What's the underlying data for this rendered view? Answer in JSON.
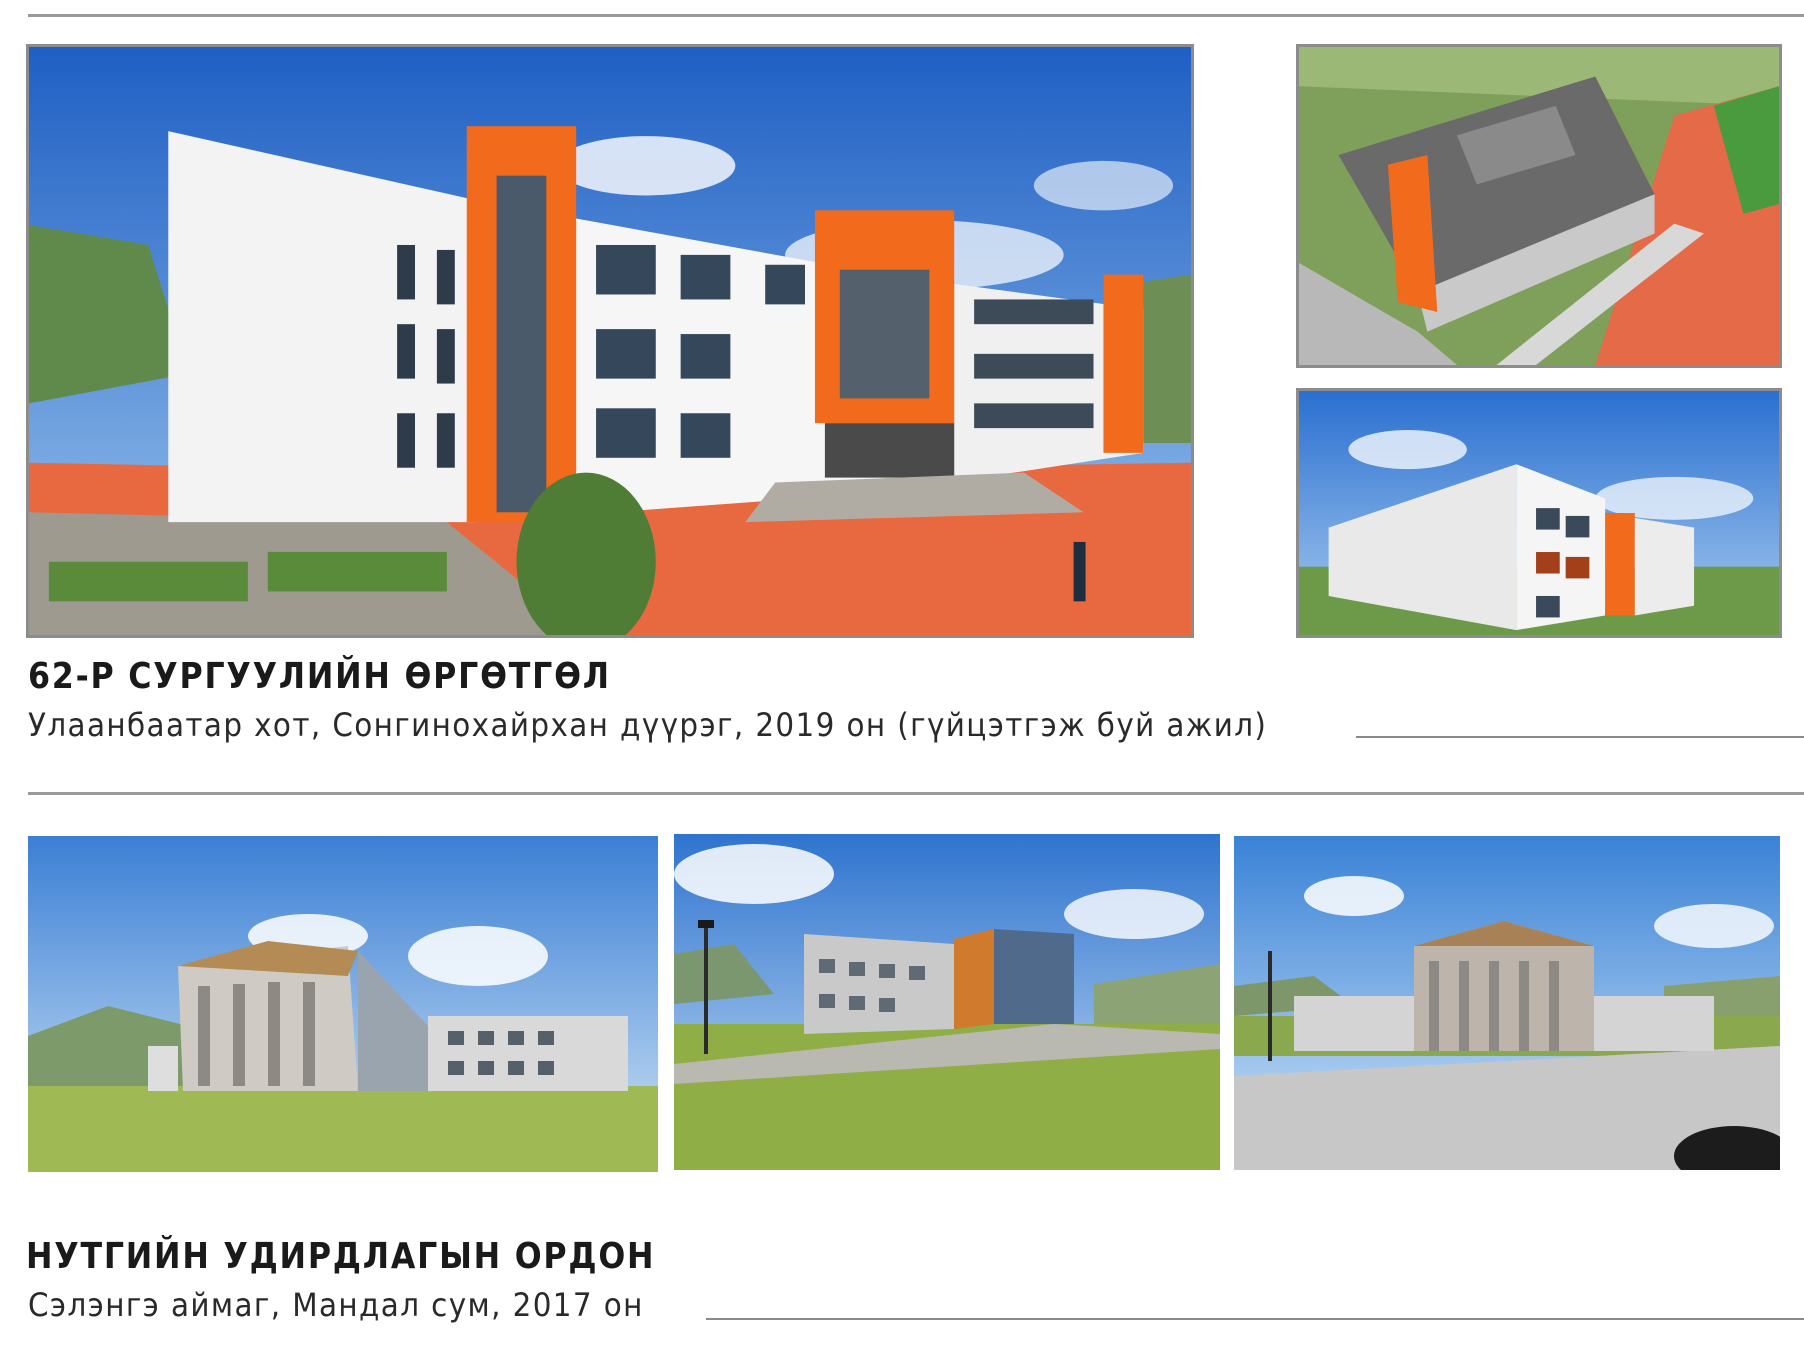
{
  "project1": {
    "title": "62-Р СУРГУУЛИЙН ӨРГӨТГӨЛ",
    "subtitle": "Улаанбаатар хот, Сонгинохайрхан дүүрэг, 2019 он (гүйцэтгэж буй ажил)"
  },
  "project2": {
    "title": "НУТГИЙН УДИРДЛАГЫН ОРДОН",
    "subtitle": "Сэлэнгэ аймаг, Мандал сум, 2017 он"
  },
  "colors": {
    "accent_orange": "#f26a1b",
    "sky_blue": "#3a7fd0",
    "rule_gray": "#9a9a9a",
    "grass_green": "#6f9a3a"
  }
}
